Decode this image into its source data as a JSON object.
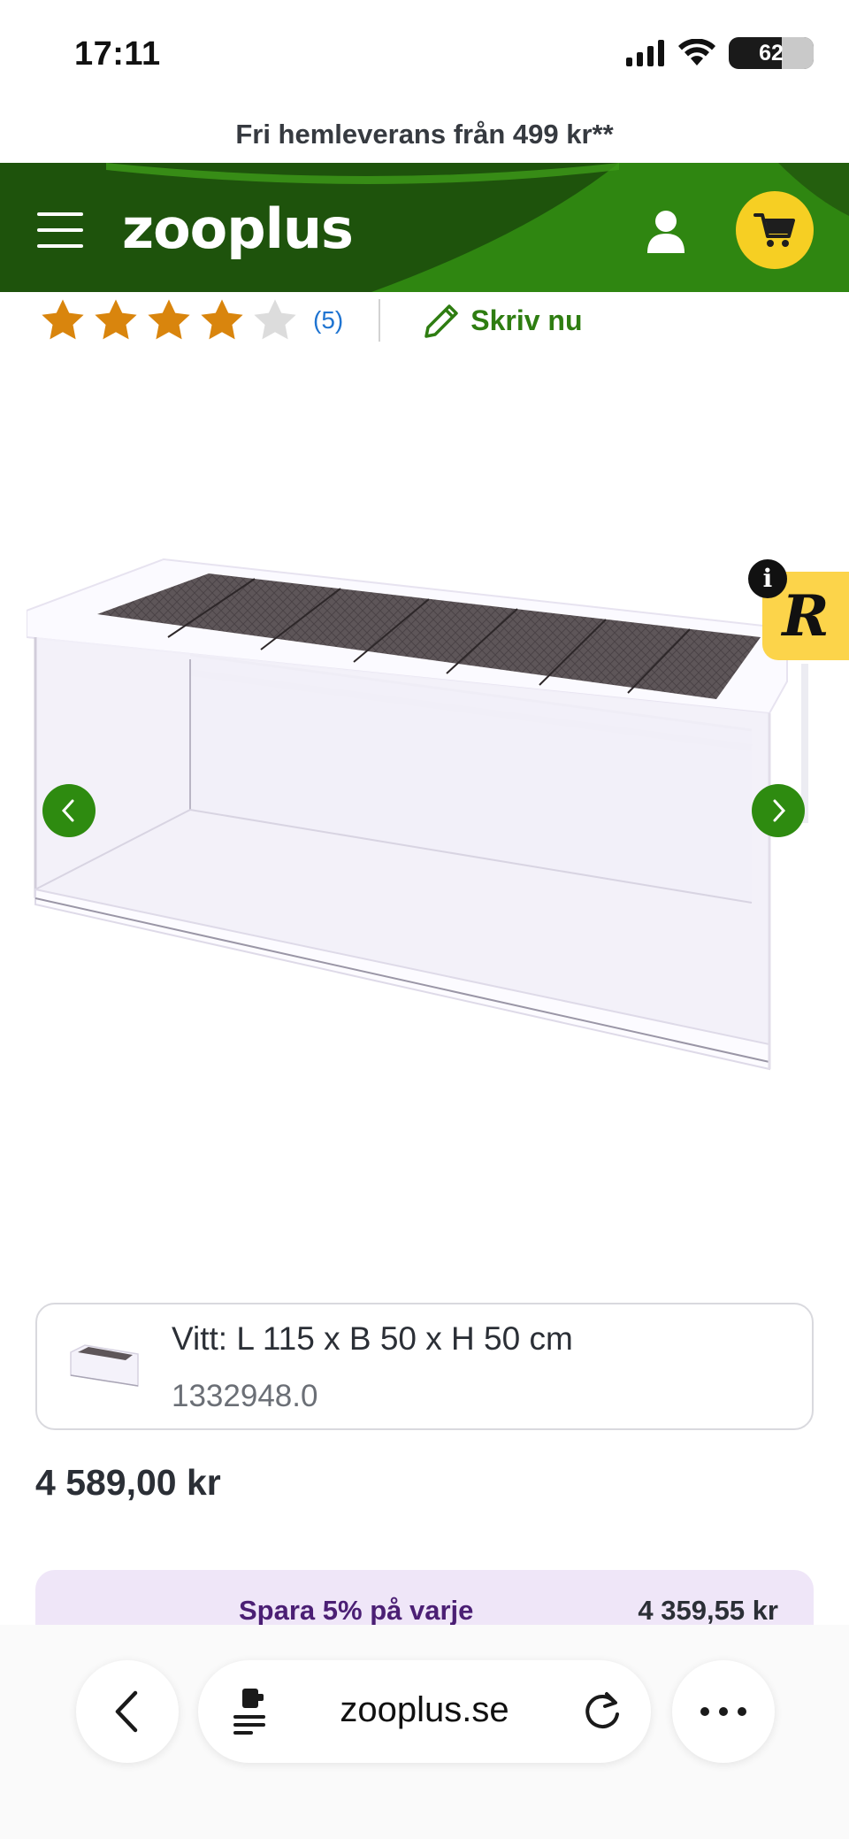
{
  "status_bar": {
    "time": "17:11",
    "battery": "62"
  },
  "promo": {
    "text": "Fri hemleverans från 499 kr**"
  },
  "header": {
    "logo": "zooplus"
  },
  "rating": {
    "stars_filled": 4,
    "stars_total": 5,
    "count": "(5)",
    "write_label": "Skriv nu"
  },
  "review_widget": {
    "letter": "R",
    "info": "i"
  },
  "variant": {
    "title": "Vitt: L 115 x B 50 x H 50 cm",
    "code": "1332948.0"
  },
  "price": "4 589,00 kr",
  "saving": {
    "label": "Spara 5% på varje",
    "price": "4 359,55 kr"
  },
  "browser": {
    "url": "zooplus.se"
  },
  "colors": {
    "brand_green": "#1f5a0c",
    "accent_green": "#2e8b10",
    "cart_yellow": "#f6cf23",
    "star_orange": "#d9850d",
    "link_blue": "#1f74d1"
  }
}
